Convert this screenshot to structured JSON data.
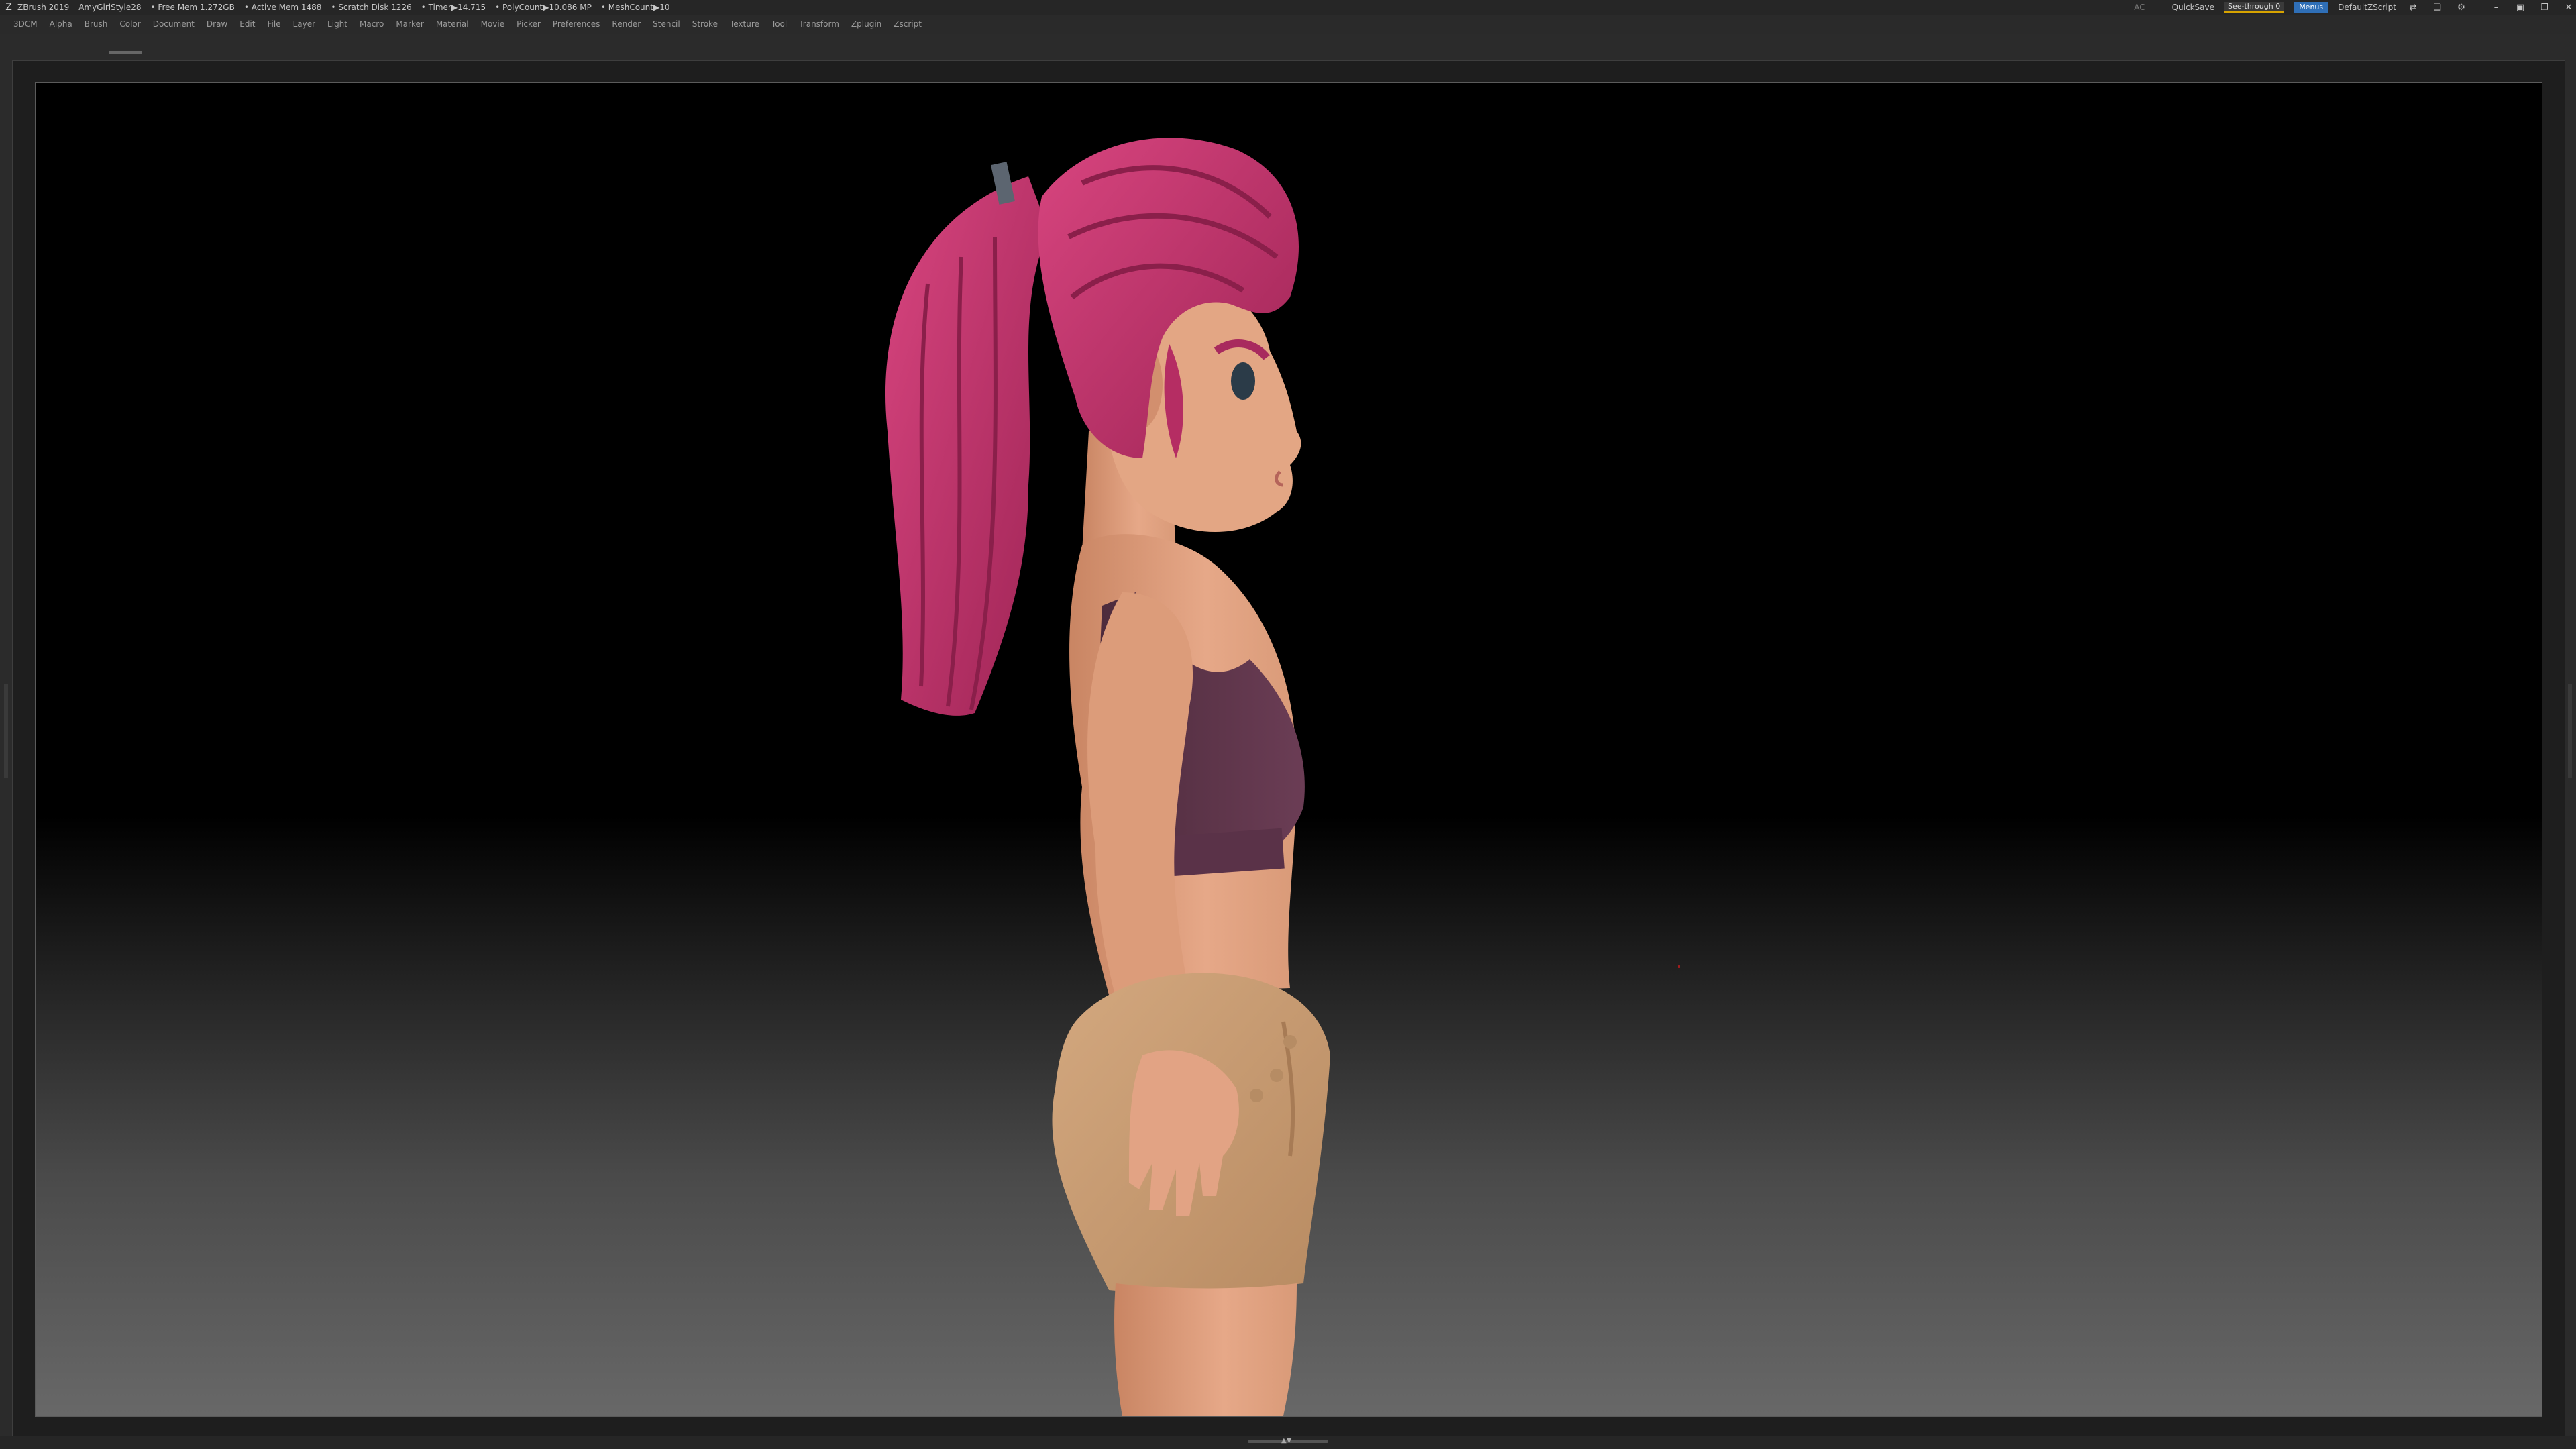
{
  "titlebar": {
    "app": "ZBrush 2019",
    "ui_config": "AmyGirlStyle28",
    "free_mem": "• Free Mem 1.272GB",
    "active_mem": "• Active Mem 1488",
    "scratch_disk": "• Scratch Disk 1226",
    "timer": "• Timer▶14.715",
    "poly_count": "• PolyCount▶10.086 MP",
    "mesh_count": "• MeshCount▶10",
    "ac": "AC",
    "quicksave": "QuickSave",
    "see_through": "See-through   0",
    "menus": "Menus",
    "default_zscript": "DefaultZScript"
  },
  "menubar": [
    "3DCM",
    "Alpha",
    "Brush",
    "Color",
    "Document",
    "Draw",
    "Edit",
    "File",
    "Layer",
    "Light",
    "Macro",
    "Marker",
    "Material",
    "Movie",
    "Picker",
    "Preferences",
    "Render",
    "Stencil",
    "Stroke",
    "Texture",
    "Tool",
    "Transform",
    "Zplugin",
    "Zscript"
  ],
  "colors": {
    "hair": "#c2346e",
    "skin": "#e0a07e",
    "top": "#5b3347",
    "shorts": "#c49a72",
    "accent": "#2f6fb7"
  }
}
